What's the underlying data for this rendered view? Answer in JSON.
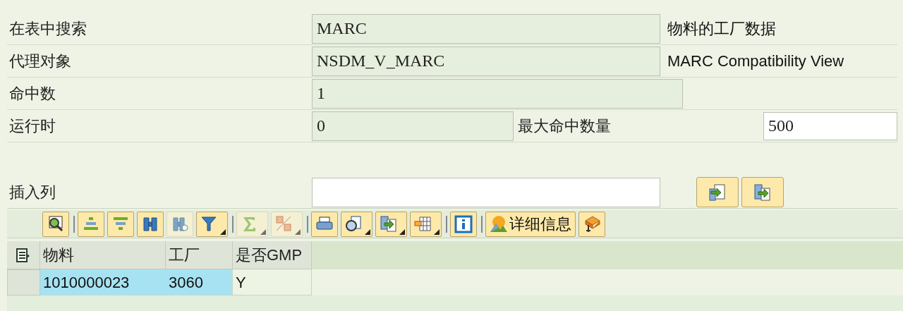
{
  "fields": [
    {
      "label": "在表中搜索",
      "value": "MARC",
      "description": "物料的工厂数据"
    },
    {
      "label": "代理对象",
      "value": "NSDM_V_MARC",
      "description": "MARC Compatibility View"
    },
    {
      "label": "命中数",
      "value": "1"
    },
    {
      "label": "运行时",
      "value": "0",
      "extra_label": "最大命中数量",
      "extra_value": "500"
    }
  ],
  "insert_column": {
    "label": "插入列"
  },
  "side_buttons": [
    {
      "kind": "left"
    },
    {
      "kind": "right"
    }
  ],
  "toolbar_groups": [
    [
      {
        "disabled": false,
        "dropdown": false
      }
    ],
    [
      {
        "disabled": false,
        "dropdown": false
      },
      {
        "disabled": false,
        "dropdown": false
      },
      {
        "disabled": false,
        "dropdown": false
      },
      {
        "disabled": true,
        "dropdown": false
      },
      {
        "disabled": false,
        "dropdown": true
      }
    ],
    [
      {
        "disabled": true,
        "dropdown": true
      },
      {
        "disabled": true,
        "dropdown": true
      }
    ],
    [
      {
        "disabled": false,
        "dropdown": false
      },
      {
        "disabled": false,
        "dropdown": true
      },
      {
        "disabled": false,
        "dropdown": true
      },
      {
        "disabled": false,
        "dropdown": true
      }
    ],
    [
      {
        "disabled": false,
        "dropdown": false
      }
    ],
    [
      {
        "label": "详细信息",
        "disabled": false,
        "dropdown": false
      },
      {
        "disabled": false,
        "dropdown": false
      }
    ]
  ],
  "table": {
    "columns": [
      {
        "label": "物料",
        "key": true
      },
      {
        "label": "工厂",
        "key": true
      },
      {
        "label": "是否GMP",
        "key": false
      }
    ],
    "rows": [
      {
        "cells": [
          "1010000023",
          "3060",
          "Y"
        ]
      }
    ]
  }
}
